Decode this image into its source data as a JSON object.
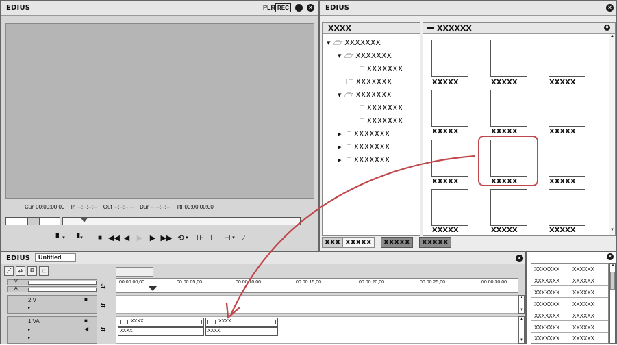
{
  "player": {
    "title": "EDIUS",
    "mode_label": "PLR",
    "rec_label": "REC",
    "cur": "Cur 00:00:00;00",
    "in": "In --:--:--;--",
    "out": "Out --:--:--;--",
    "dur": "Dur --:--:--;--",
    "ttl": "Ttl 00:00:00;00"
  },
  "bin": {
    "title": "EDIUS",
    "folder_header": "XXXX",
    "content_header": "XXXXXX",
    "tree": [
      "XXXXXXX",
      "XXXXXXX",
      "XXXXXXX",
      "XXXXXXX",
      "XXXXXXX",
      "XXXXXXX",
      "XXXXXXX",
      "XXXXXXX",
      "XXXXXXX",
      "XXXXXXX"
    ],
    "clip_labels": [
      "XXXXX",
      "XXXXX",
      "XXXXX",
      "XXXXX",
      "XXXXX",
      "XXXXX",
      "XXXXX",
      "XXXXX",
      "XXXXX",
      "XXXXX",
      "XXXXX",
      "XXXXX"
    ],
    "tabs": [
      "XXX",
      "XXXXX",
      "XXXXX",
      "XXXXX"
    ]
  },
  "timeline": {
    "title": "EDIUS",
    "sequence_name": "Untitled",
    "track_v": "V",
    "track_a": "A",
    "track_2v": "2 V",
    "track_1va": "1 VA",
    "ruler": [
      "00:00:00;00",
      "00:00:05;00",
      "00:00:10;00",
      "00:00:15;00",
      "00:00:20;00",
      "00:00:25;00",
      "00:00:30;00"
    ],
    "clips": [
      {
        "video": "XXXX",
        "audio": "XXXX"
      },
      {
        "video": "XXXX",
        "audio": "XXXX"
      }
    ]
  },
  "info_panel": {
    "rows": [
      [
        "XXXXXXX",
        "XXXXXX"
      ],
      [
        "XXXXXXX",
        "XXXXXX"
      ],
      [
        "XXXXXXX",
        "XXXXXX"
      ],
      [
        "XXXXXXX",
        "XXXXXX"
      ],
      [
        "XXXXXXX",
        "XXXXXX"
      ],
      [
        "XXXXXXX",
        "XXXXXX"
      ],
      [
        "XXXXXXX",
        "XXXXXX"
      ]
    ]
  },
  "colors": {
    "highlight": "#c0474b",
    "arrow": "#c0474b",
    "tab_active": "#8a8a8a"
  }
}
